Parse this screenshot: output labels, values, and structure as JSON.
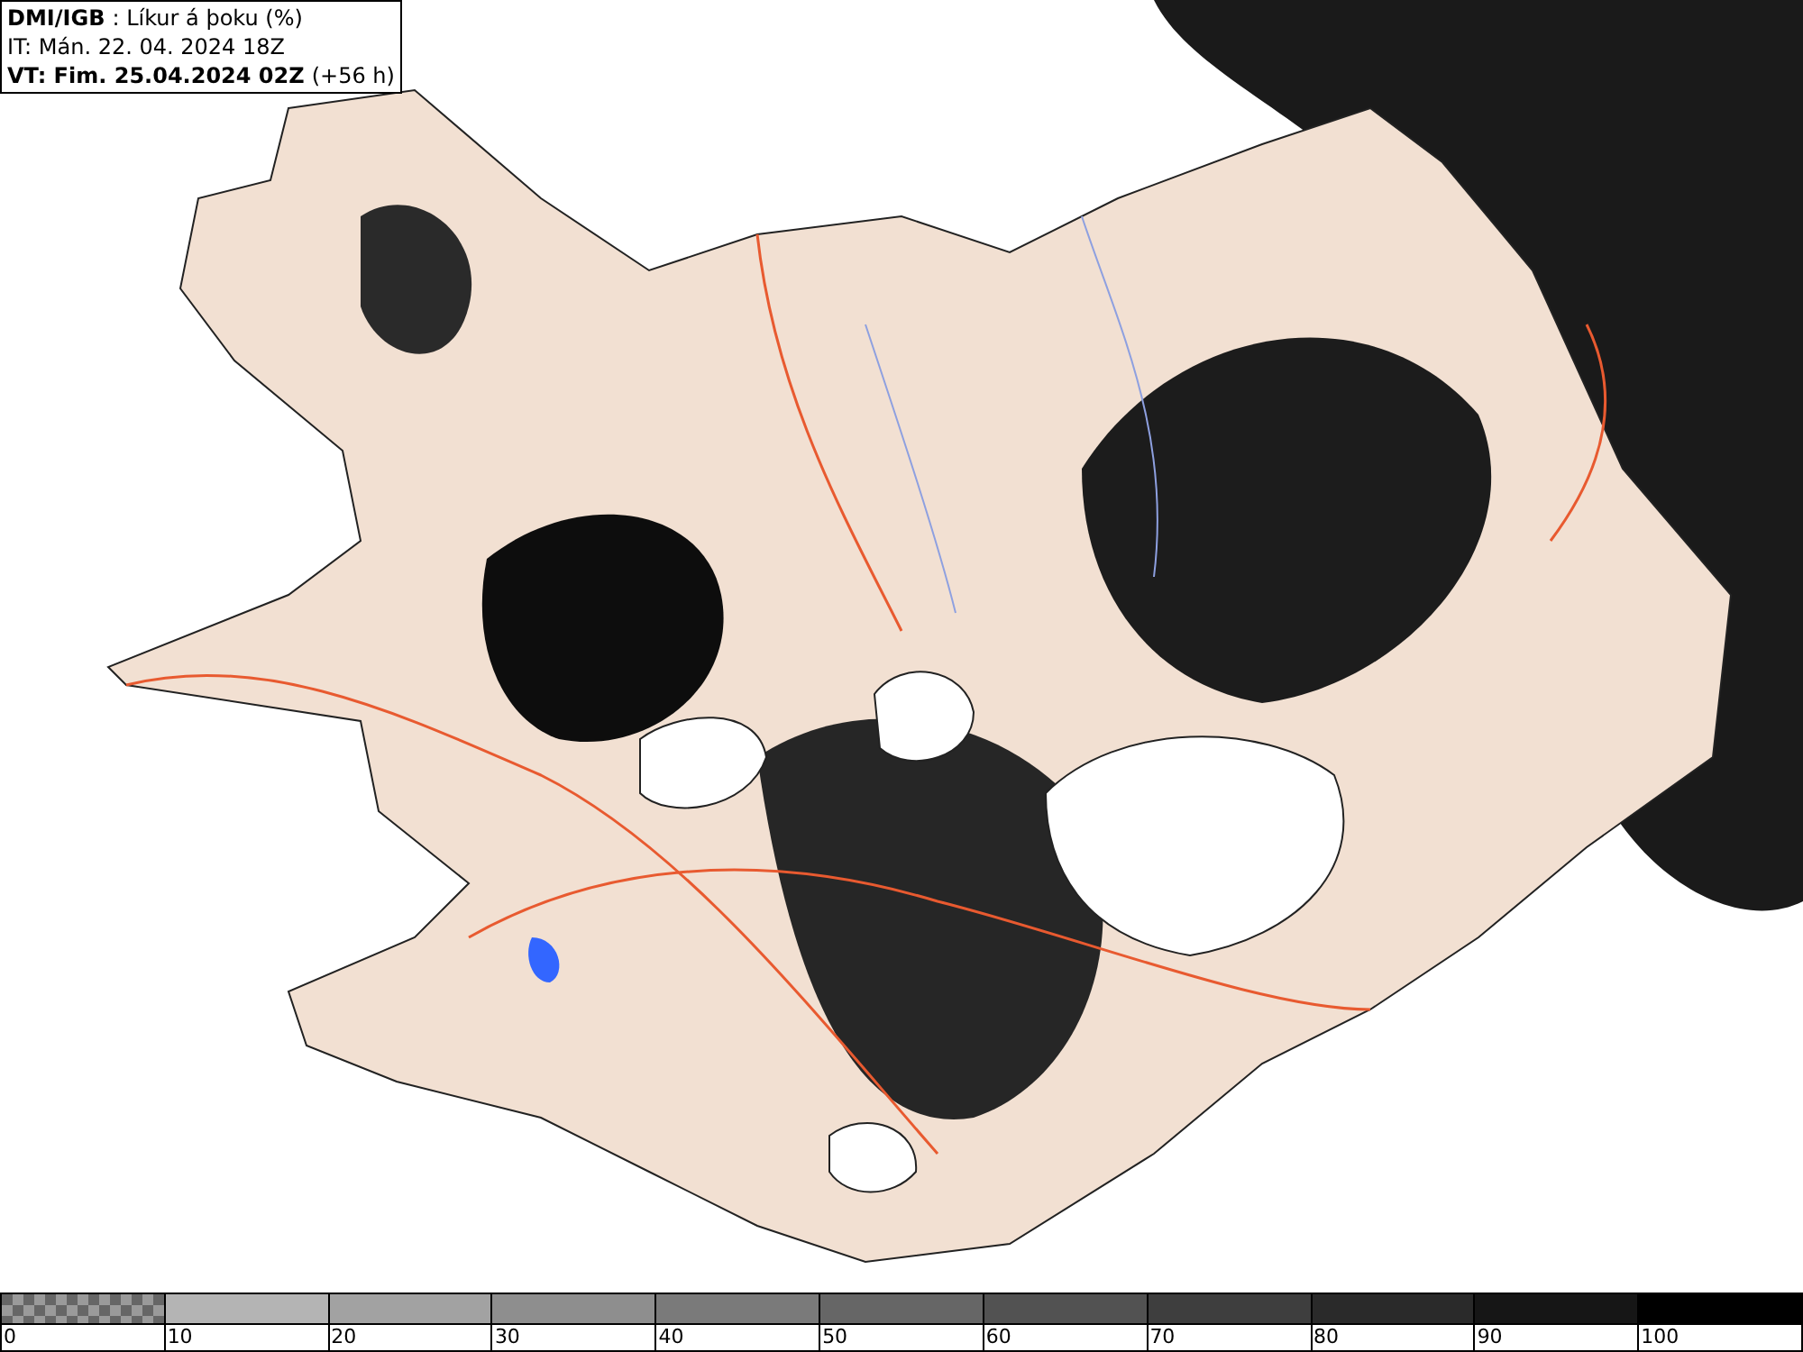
{
  "header": {
    "source": "DMI/IGB",
    "title": ": Líkur á þoku (%)",
    "issue_time": "IT: Mán. 22. 04. 2024 18Z",
    "valid_time": "VT: Fim. 25.04.2024 02Z",
    "lead": "(+56 h)"
  },
  "legend": [
    {
      "label": "0",
      "kind": "checker",
      "color": "#9a9a9a"
    },
    {
      "label": "10",
      "kind": "solid",
      "color": "#b4b4b4"
    },
    {
      "label": "20",
      "kind": "solid",
      "color": "#a2a2a2"
    },
    {
      "label": "30",
      "kind": "solid",
      "color": "#8e8e8e"
    },
    {
      "label": "40",
      "kind": "solid",
      "color": "#7a7a7a"
    },
    {
      "label": "50",
      "kind": "solid",
      "color": "#666666"
    },
    {
      "label": "60",
      "kind": "solid",
      "color": "#525252"
    },
    {
      "label": "70",
      "kind": "solid",
      "color": "#3e3e3e"
    },
    {
      "label": "80",
      "kind": "solid",
      "color": "#2a2a2a"
    },
    {
      "label": "90",
      "kind": "solid",
      "color": "#161616"
    },
    {
      "label": "100",
      "kind": "solid",
      "color": "#000000"
    }
  ]
}
